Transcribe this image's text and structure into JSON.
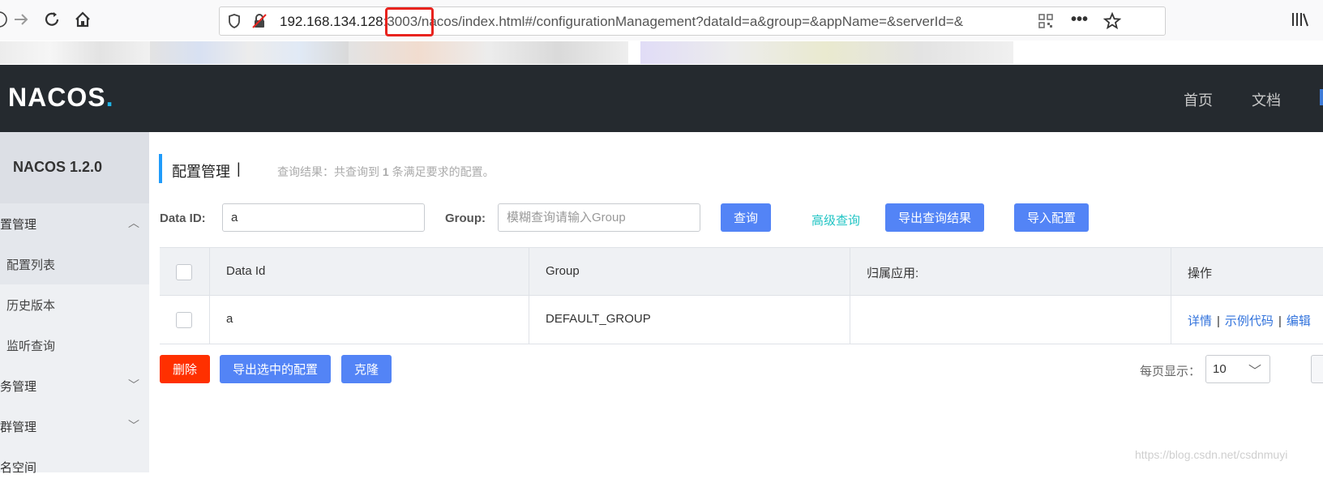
{
  "browser": {
    "url_host": "192.168.134.128",
    "url_port": ":3003/",
    "url_path": "nacos/index.html#/configurationManagement?dataId=a&group=&appName=&serverId=&"
  },
  "header": {
    "logo_text": "NACOS",
    "logo_dot": ".",
    "nav": [
      "首页",
      "文档"
    ]
  },
  "sidebar": {
    "version": "NACOS 1.2.0",
    "items": [
      {
        "label": "置管理",
        "chevron": "︿"
      },
      {
        "label": "配置列表"
      },
      {
        "label": "历史版本"
      },
      {
        "label": "监听查询"
      },
      {
        "label": "务管理",
        "chevron": "﹀"
      },
      {
        "label": "群管理",
        "chevron": "﹀"
      },
      {
        "label": "名空间"
      }
    ]
  },
  "main": {
    "title": "配置管理",
    "title_sep": "|",
    "result_prefix": "查询结果：共查询到 ",
    "result_count": "1",
    "result_suffix": " 条满足要求的配置。",
    "search": {
      "data_id_label": "Data ID:",
      "data_id_value": "a",
      "group_label": "Group:",
      "group_placeholder": "模糊查询请输入Group",
      "query_button": "查询",
      "advanced_query": "高级查询",
      "export_results": "导出查询结果",
      "import_config": "导入配置"
    },
    "table": {
      "columns": [
        "Data Id",
        "Group",
        "归属应用:",
        "操作"
      ],
      "rows": [
        {
          "data_id": "a",
          "group": "DEFAULT_GROUP",
          "app": "",
          "ops": [
            "详情",
            "示例代码",
            "编辑"
          ]
        }
      ]
    },
    "actions": {
      "delete": "删除",
      "export_selected": "导出选中的配置",
      "clone": "克隆"
    },
    "pagination": {
      "page_size_label": "每页显示：",
      "page_size": "10"
    }
  },
  "watermark": "https://blog.csdn.net/csdnmuyi",
  "colors": {
    "primary": "#5384f6",
    "danger": "#ff3000",
    "header_bg": "#252a2f",
    "highlight": "#e8231e"
  }
}
